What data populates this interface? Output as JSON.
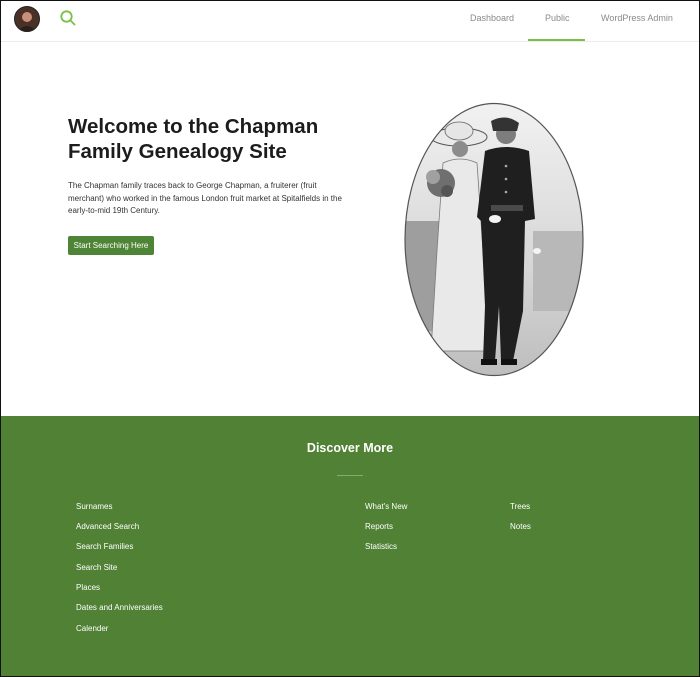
{
  "header": {
    "avatar_icon": "user-avatar",
    "search_icon": "search-icon",
    "nav": [
      {
        "label": "Dashboard",
        "active": false
      },
      {
        "label": "Public",
        "active": true
      },
      {
        "label": "WordPress Admin",
        "active": false
      }
    ],
    "accent_color": "#7ac046"
  },
  "hero": {
    "title": "Welcome to the Chapman Family Genealogy Site",
    "description": "The Chapman family traces back to George Chapman, a fruiterer (fruit merchant) who worked in the famous London fruit market at Spitalfields in the early-to-mid 19th Century.",
    "cta_label": "Start Searching Here",
    "cta_color": "#4e8435",
    "photo": "oval sepia portrait of a couple: woman in hat with flowers, man in military uniform"
  },
  "footer": {
    "title": "Discover More",
    "background": "#508135",
    "columns": [
      [
        "Surnames",
        "Advanced Search",
        "Search Families",
        "Search Site",
        "Places",
        "Dates and Anniversaries",
        "Calender"
      ],
      [
        "What's New",
        "Reports",
        "Statistics"
      ],
      [
        "Trees",
        "Notes"
      ]
    ]
  }
}
